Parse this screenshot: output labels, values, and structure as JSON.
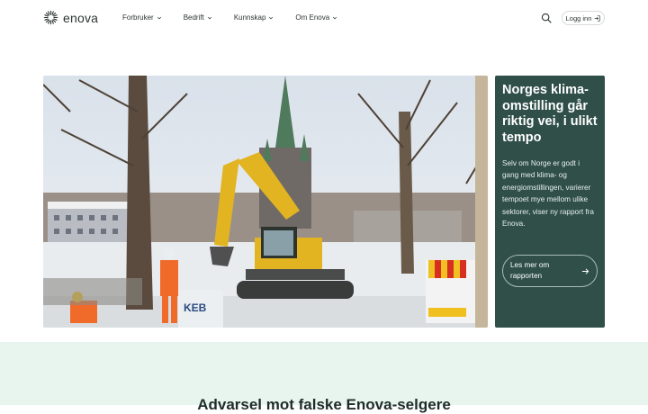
{
  "header": {
    "logo_text": "enova",
    "nav": [
      {
        "label": "Forbruker"
      },
      {
        "label": "Bedrift"
      },
      {
        "label": "Kunnskap"
      },
      {
        "label": "Om Enova"
      }
    ],
    "login_label": "Logg inn"
  },
  "hero": {
    "image_badge": "KEB",
    "card": {
      "title": "Norges klima-omstilling går riktig vei, i ulikt tempo",
      "body": "Selv om Norge er godt i gang med klima- og energiomstillingen, varierer tempoet mye mellom ulike sektorer, viser ny rapport fra Enova.",
      "button_label": "Les mer om rapporten"
    }
  },
  "notice": {
    "title": "Advarsel mot falske Enova-selgere"
  },
  "colors": {
    "card_bg": "#2f4f48",
    "band_bg": "#e8f5ee",
    "text": "#1e2d2a"
  }
}
